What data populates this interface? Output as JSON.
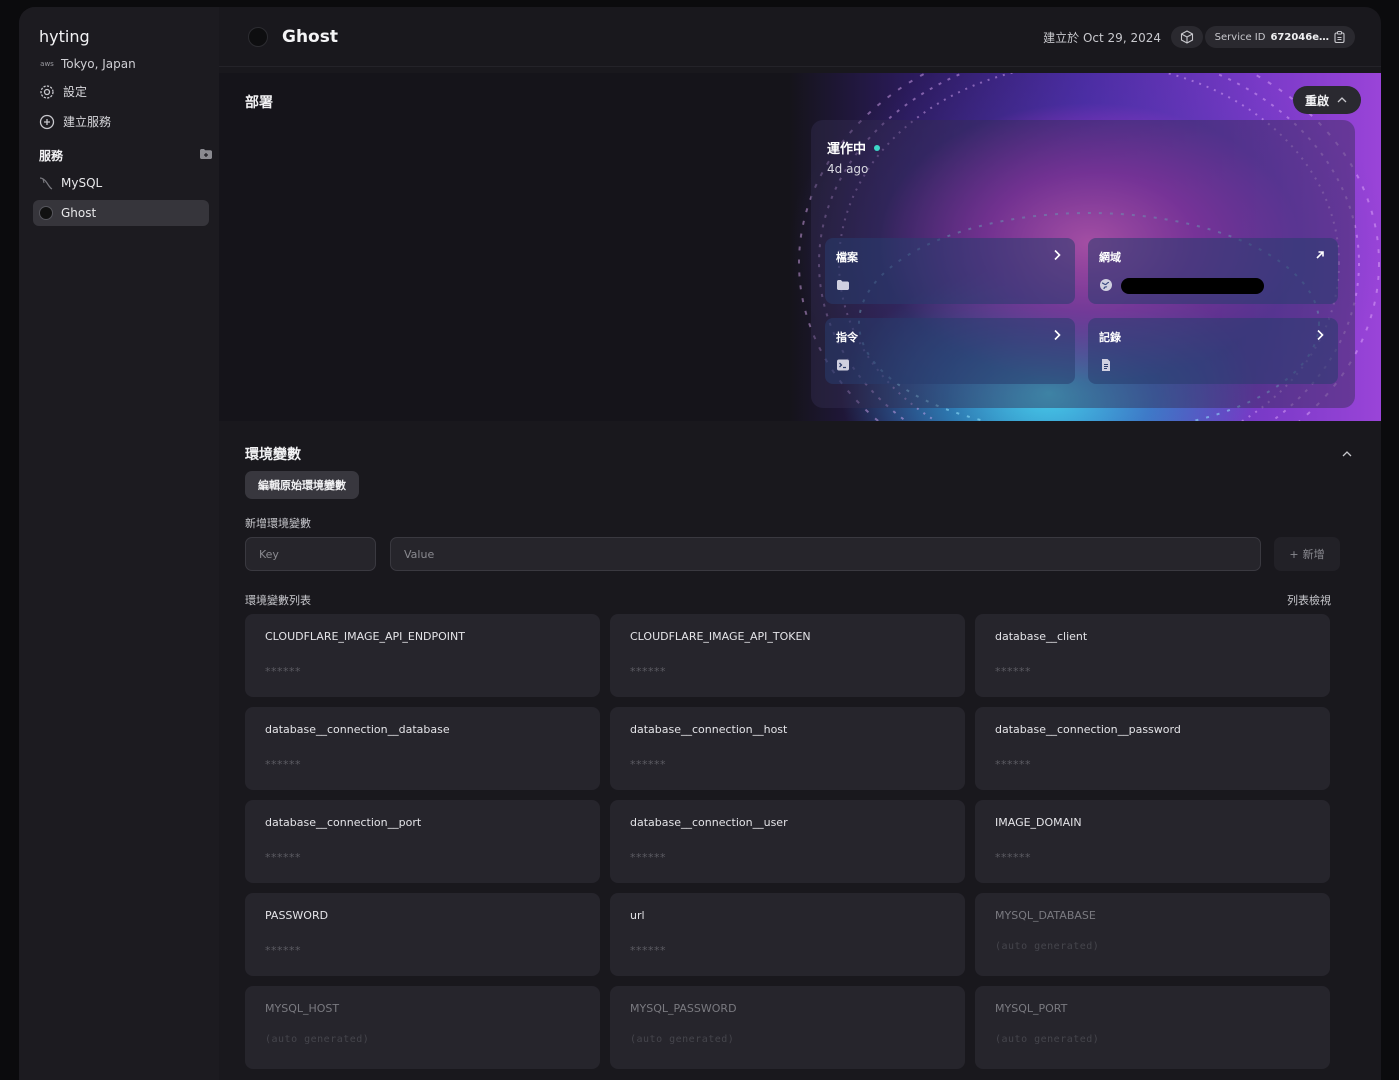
{
  "sidebar": {
    "project_name": "hyting",
    "region_provider": "aws",
    "region": "Tokyo, Japan",
    "settings_label": "設定",
    "create_service_label": "建立服務",
    "services_heading": "服務",
    "services": [
      {
        "name": "MySQL",
        "icon": "mysql-icon"
      },
      {
        "name": "Ghost",
        "icon": "ghost-icon",
        "active": true
      }
    ]
  },
  "header": {
    "service_name": "Ghost",
    "created": "建立於 Oct 29, 2024",
    "service_id_label": "Service ID",
    "service_id_value": "672046e…"
  },
  "deploy": {
    "heading": "部署",
    "restart_label": "重啟",
    "status": "運作中",
    "status_color": "#3dd6c8",
    "ago": "4d ago",
    "tiles": {
      "files": "檔案",
      "domain": "網域",
      "command": "指令",
      "logs": "記錄"
    }
  },
  "env": {
    "heading": "環境變數",
    "edit_raw_label": "編輯原始環境變數",
    "add_label": "新增環境變數",
    "key_placeholder": "Key",
    "value_placeholder": "Value",
    "add_button": "新增",
    "list_label": "環境變數列表",
    "view_toggle": "列表檢視",
    "vars": [
      {
        "key": "CLOUDFLARE_IMAGE_API_ENDPOINT",
        "value": "******"
      },
      {
        "key": "CLOUDFLARE_IMAGE_API_TOKEN",
        "value": "******"
      },
      {
        "key": "database__client",
        "value": "******"
      },
      {
        "key": "database__connection__database",
        "value": "******"
      },
      {
        "key": "database__connection__host",
        "value": "******"
      },
      {
        "key": "database__connection__password",
        "value": "******"
      },
      {
        "key": "database__connection__port",
        "value": "******"
      },
      {
        "key": "database__connection__user",
        "value": "******"
      },
      {
        "key": "IMAGE_DOMAIN",
        "value": "******"
      },
      {
        "key": "PASSWORD",
        "value": "******"
      },
      {
        "key": "url",
        "value": "******"
      },
      {
        "key": "MYSQL_DATABASE",
        "value": "(auto generated)",
        "auto": true
      },
      {
        "key": "MYSQL_HOST",
        "value": "(auto generated)",
        "auto": true
      },
      {
        "key": "MYSQL_PASSWORD",
        "value": "(auto generated)",
        "auto": true
      },
      {
        "key": "MYSQL_PORT",
        "value": "(auto generated)",
        "auto": true
      }
    ]
  }
}
